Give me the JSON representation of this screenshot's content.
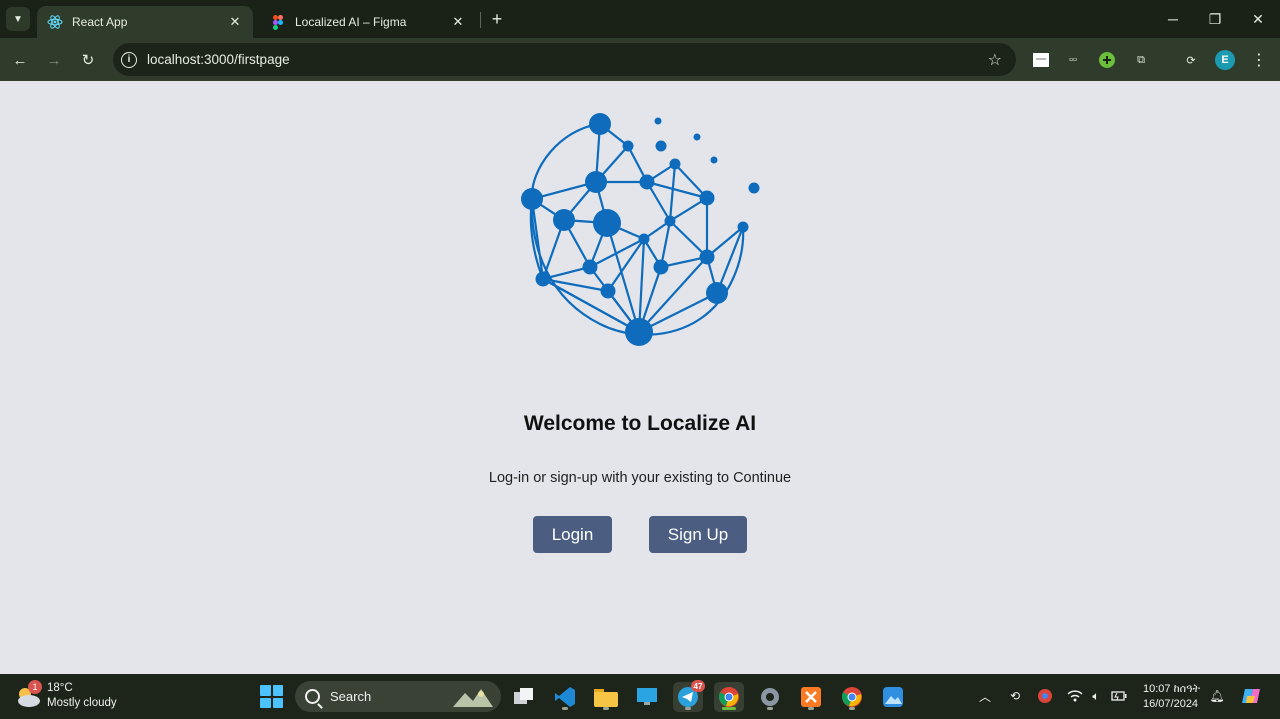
{
  "browser": {
    "tabs": [
      {
        "title": "React App",
        "icon": "react-icon",
        "active": true
      },
      {
        "title": "Localized AI – Figma",
        "icon": "figma-icon",
        "active": false
      }
    ],
    "url": "localhost:3000/firstpage",
    "profile_initial": "E"
  },
  "page": {
    "heading": "Welcome to Localize AI",
    "subtitle": "Log-in or sign-up with your existing to Continue",
    "login_label": "Login",
    "signup_label": "Sign Up"
  },
  "taskbar": {
    "weather": {
      "temp": "18°C",
      "condition": "Mostly cloudy",
      "badge": "1"
    },
    "search_placeholder": "Search",
    "telegram_badge": "47",
    "clock": {
      "time": "10:07 ከሰዓት",
      "date": "16/07/2024"
    }
  },
  "colors": {
    "accent": "#4b5d80",
    "logo": "#0f6cbd",
    "page_bg": "#e3e5ea"
  }
}
